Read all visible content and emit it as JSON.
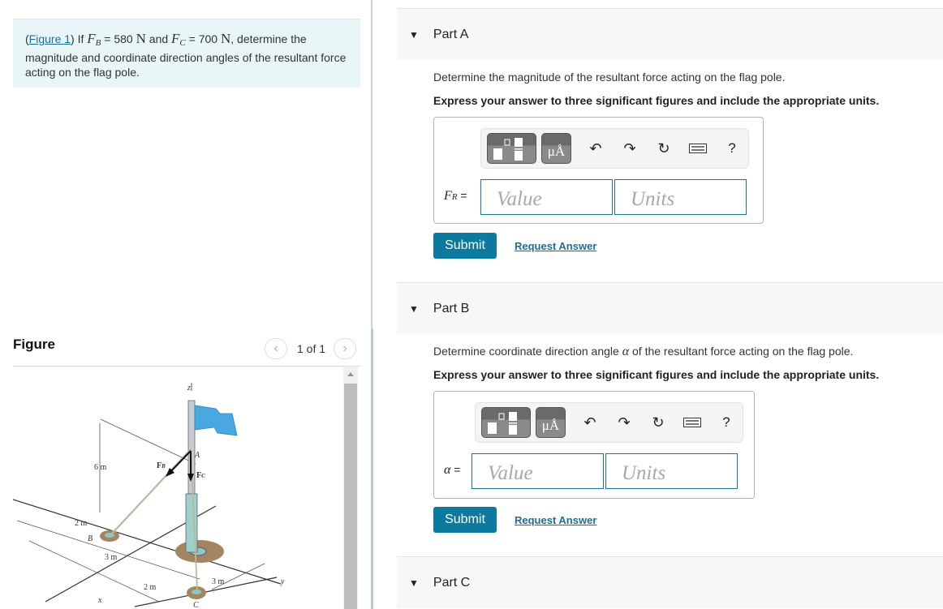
{
  "problem": {
    "figure_link": "Figure 1",
    "text_if": "If",
    "fb_symbol": "F",
    "fb_sub": "B",
    "fb_value": "= 580",
    "fb_unit": "N",
    "and": "and",
    "fc_symbol": "F",
    "fc_sub": "C",
    "fc_value": "= 700",
    "fc_unit": "N",
    "rest": ", determine the magnitude and coordinate direction angles of the resultant force acting on the flag pole."
  },
  "figure": {
    "title": "Figure",
    "counter": "1 of 1",
    "prev_icon": "chevron-left-icon",
    "next_icon": "chevron-right-icon",
    "labels": {
      "z": "z",
      "A": "A",
      "FB": "F",
      "FB_sub": "B",
      "FC": "F",
      "FC_sub": "C",
      "six_m": "6 m",
      "two_m_left": "2 m",
      "B": "B",
      "three_m_left": "3 m",
      "two_m_bottom": "2 m",
      "three_m_right": "3 m",
      "C": "C",
      "x": "x",
      "y": "y"
    },
    "flag_color": "#4aa8e0"
  },
  "toolbar": {
    "templates_icon": "templates-icon",
    "units_label": "μÅ",
    "undo_icon": "undo-icon",
    "redo_icon": "redo-icon",
    "reset_icon": "reset-icon",
    "keyboard_icon": "keyboard-icon",
    "help_label": "?"
  },
  "parts": [
    {
      "title": "Part A",
      "question": "Determine the magnitude of the resultant force acting on the flag pole.",
      "instruction": "Express your answer to three significant figures and include the appropriate units.",
      "answer_symbol": "F",
      "answer_sub": "R",
      "answer_eq": " =",
      "value_placeholder": "Value",
      "units_placeholder": "Units",
      "submit_label": "Submit",
      "request_label": "Request Answer"
    },
    {
      "title": "Part B",
      "question_pre": "Determine coordinate direction angle",
      "question_symbol": "α",
      "question_post": "of the resultant force acting on the flag pole.",
      "instruction": "Express your answer to three significant figures and include the appropriate units.",
      "answer_symbol": "α",
      "answer_eq": " =",
      "value_placeholder": "Value",
      "units_placeholder": "Units",
      "submit_label": "Submit",
      "request_label": "Request Answer"
    },
    {
      "title": "Part C"
    }
  ],
  "colors": {
    "accent": "#0c7a9f",
    "link": "#1a6e99",
    "intro_bg": "#e8f6f8",
    "part_header_bg": "#f7f7f7"
  }
}
